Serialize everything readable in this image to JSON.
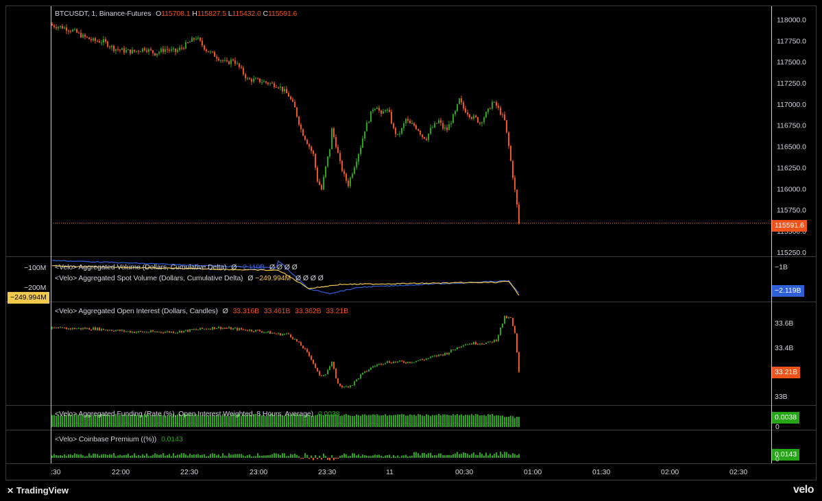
{
  "colors": {
    "up": "#26a516",
    "down": "#f0531c",
    "cvd_perp": "#2f5fd6",
    "cvd_spot": "#f2c94c",
    "grid": "#2a2a2a",
    "text": "#d1d4dc"
  },
  "header": {
    "symbol": "BTCUSDT, 1, Binance-Futures",
    "o_label": "O",
    "o": "115708.1",
    "h_label": "H",
    "h": "115827.5",
    "l_label": "L",
    "l": "115432.0",
    "c_label": "C",
    "c": "115591.6"
  },
  "cvd_header": {
    "line1": "<Velo> Aggregated Volume (Dollars, Cumulative Delta)",
    "line1_value": "−2.119B",
    "line2": "<Velo> Aggregated Spot Volume (Dollars, Cumulative Delta)",
    "line2_value": "−249.994M",
    "null_marks": "Ø Ø Ø Ø"
  },
  "oi_header": {
    "title": "<Velo> Aggregated Open Interest (Dollars, Candles)",
    "o": "33.316B",
    "h": "33.461B",
    "l": "33.362B",
    "c": "33.21B"
  },
  "funding_header": {
    "title": "<Velo> Aggregated Funding (Rate (%), Open Interest Weighted, 8 Hours, Average)",
    "value": "0.0038"
  },
  "premium_header": {
    "title": "<Velo> Coinbase Premium ((%))",
    "value": "0.0143"
  },
  "null_sym": "Ø",
  "badges": {
    "price": "115591.6",
    "cvd_perp": "−2.119B",
    "cvd_spot": "−249.994M",
    "oi": "33.21B",
    "funding": "0.0038",
    "funding_zero": "0",
    "premium": "0.0143",
    "premium_zero": "0"
  },
  "cvd_axis": {
    "left": [
      "−100M",
      "−200M"
    ],
    "right": [
      "−1B"
    ]
  },
  "oi_axis": [
    "33.6B",
    "33.4B",
    "33B"
  ],
  "price_axis": [
    "118000.0",
    "117750.0",
    "117500.0",
    "117250.0",
    "117000.0",
    "116750.0",
    "116500.0",
    "116250.0",
    "116000.0",
    "115750.0",
    "115500.0",
    "115250.0"
  ],
  "time_axis": [
    ":30",
    "22:00",
    "22:30",
    "23:00",
    "23:30",
    "11",
    "00:30",
    "01:00",
    "01:30",
    "02:00",
    "02:30"
  ],
  "footer": {
    "brand": "TradingView",
    "watermark": "velo"
  },
  "chart_data": [
    {
      "type": "candlestick",
      "title": "BTCUSDT, 1, Binance-Futures",
      "ylim": [
        115200,
        118150
      ],
      "last_price": 115591.6,
      "close_path": [
        [
          0,
          117930
        ],
        [
          5,
          117910
        ],
        [
          10,
          117870
        ],
        [
          15,
          117800
        ],
        [
          20,
          117750
        ],
        [
          25,
          117740
        ],
        [
          30,
          117660
        ],
        [
          35,
          117630
        ],
        [
          40,
          117620
        ],
        [
          45,
          117660
        ],
        [
          50,
          117600
        ],
        [
          55,
          117650
        ],
        [
          60,
          117620
        ],
        [
          65,
          117700
        ],
        [
          70,
          117790
        ],
        [
          75,
          117640
        ],
        [
          80,
          117560
        ],
        [
          85,
          117480
        ],
        [
          88,
          117530
        ],
        [
          92,
          117400
        ],
        [
          95,
          117290
        ],
        [
          100,
          117280
        ],
        [
          105,
          117250
        ],
        [
          110,
          117220
        ],
        [
          115,
          117100
        ],
        [
          118,
          116950
        ],
        [
          121,
          116700
        ],
        [
          124,
          116550
        ],
        [
          127,
          116400
        ],
        [
          129,
          116100
        ],
        [
          131,
          115990
        ],
        [
          133,
          116250
        ],
        [
          135,
          116480
        ],
        [
          136,
          116700
        ],
        [
          138,
          116520
        ],
        [
          140,
          116300
        ],
        [
          142,
          116150
        ],
        [
          144,
          116050
        ],
        [
          146,
          116200
        ],
        [
          148,
          116350
        ],
        [
          150,
          116500
        ],
        [
          152,
          116700
        ],
        [
          154,
          116820
        ],
        [
          156,
          116950
        ],
        [
          158,
          116980
        ],
        [
          160,
          116860
        ],
        [
          162,
          116950
        ],
        [
          164,
          116880
        ],
        [
          166,
          116700
        ],
        [
          168,
          116620
        ],
        [
          170,
          116700
        ],
        [
          172,
          116820
        ],
        [
          174,
          116760
        ],
        [
          176,
          116750
        ],
        [
          178,
          116700
        ],
        [
          180,
          116620
        ],
        [
          182,
          116600
        ],
        [
          184,
          116700
        ],
        [
          186,
          116750
        ],
        [
          188,
          116800
        ],
        [
          190,
          116720
        ],
        [
          192,
          116700
        ],
        [
          194,
          116800
        ],
        [
          196,
          116900
        ],
        [
          198,
          117050
        ],
        [
          200,
          116950
        ],
        [
          202,
          116900
        ],
        [
          204,
          116850
        ],
        [
          206,
          116830
        ],
        [
          208,
          116780
        ],
        [
          210,
          116850
        ],
        [
          212,
          116920
        ],
        [
          214,
          117020
        ],
        [
          216,
          116980
        ],
        [
          218,
          116900
        ],
        [
          220,
          116800
        ],
        [
          222,
          116500
        ],
        [
          224,
          116150
        ],
        [
          226,
          115800
        ],
        [
          227,
          115591.6
        ]
      ]
    },
    {
      "type": "line",
      "title": "Aggregated Volume / Aggregated Spot Volume (Cumulative Delta)",
      "series": [
        {
          "name": "Aggregated Volume (Dollars, Cumulative Delta)",
          "last": -2119000000
        },
        {
          "name": "Aggregated Spot Volume (Dollars, Cumulative Delta)",
          "last": -249994000
        }
      ]
    },
    {
      "type": "candlestick",
      "title": "Aggregated Open Interest (Dollars, Candles)",
      "ylim": [
        32.95,
        33.75
      ],
      "last": 33.21,
      "close_path": [
        [
          0,
          33.6
        ],
        [
          20,
          33.6
        ],
        [
          40,
          33.57
        ],
        [
          60,
          33.57
        ],
        [
          80,
          33.61
        ],
        [
          100,
          33.58
        ],
        [
          110,
          33.55
        ],
        [
          115,
          33.55
        ],
        [
          118,
          33.5
        ],
        [
          122,
          33.43
        ],
        [
          126,
          33.33
        ],
        [
          130,
          33.17
        ],
        [
          133,
          33.2
        ],
        [
          136,
          33.29
        ],
        [
          139,
          33.1
        ],
        [
          142,
          33.07
        ],
        [
          146,
          33.1
        ],
        [
          150,
          33.18
        ],
        [
          156,
          33.26
        ],
        [
          162,
          33.3
        ],
        [
          168,
          33.3
        ],
        [
          174,
          33.3
        ],
        [
          180,
          33.32
        ],
        [
          186,
          33.35
        ],
        [
          192,
          33.38
        ],
        [
          196,
          33.42
        ],
        [
          200,
          33.46
        ],
        [
          206,
          33.47
        ],
        [
          212,
          33.47
        ],
        [
          216,
          33.5
        ],
        [
          220,
          33.7
        ],
        [
          223,
          33.69
        ],
        [
          225,
          33.55
        ],
        [
          227,
          33.21
        ]
      ]
    },
    {
      "type": "bar",
      "title": "Aggregated Funding (Rate (%), Open Interest Weighted, 8 Hours, Average)",
      "last": 0.0038
    },
    {
      "type": "bar",
      "title": "Coinbase Premium ((%))",
      "last": 0.0143
    }
  ]
}
